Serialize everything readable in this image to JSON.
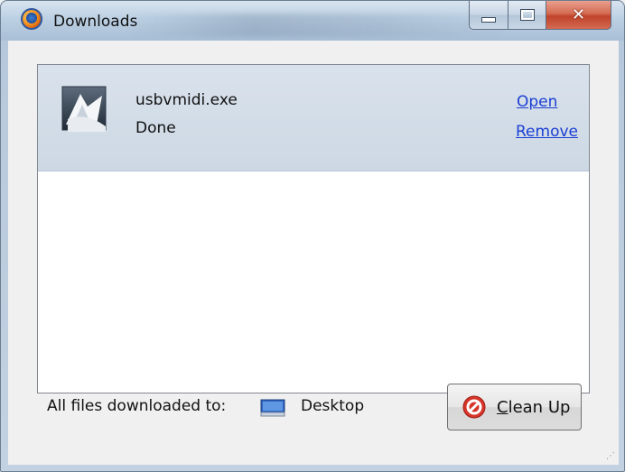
{
  "window": {
    "title": "Downloads",
    "buttons": {
      "minimize": "minimize-icon",
      "maximize": "maximize-icon",
      "close": "close-icon"
    }
  },
  "downloads": [
    {
      "name": "usbvmidi.exe",
      "status": "Done",
      "open_label": "Open",
      "remove_label": "Remove"
    }
  ],
  "footer": {
    "prefix": "All files downloaded to:",
    "location": "Desktop",
    "cleanup_mnemonic": "C",
    "cleanup_rest": "lean Up"
  },
  "colors": {
    "link": "#1c3fd3",
    "item_bg": "#d9e2ec"
  }
}
